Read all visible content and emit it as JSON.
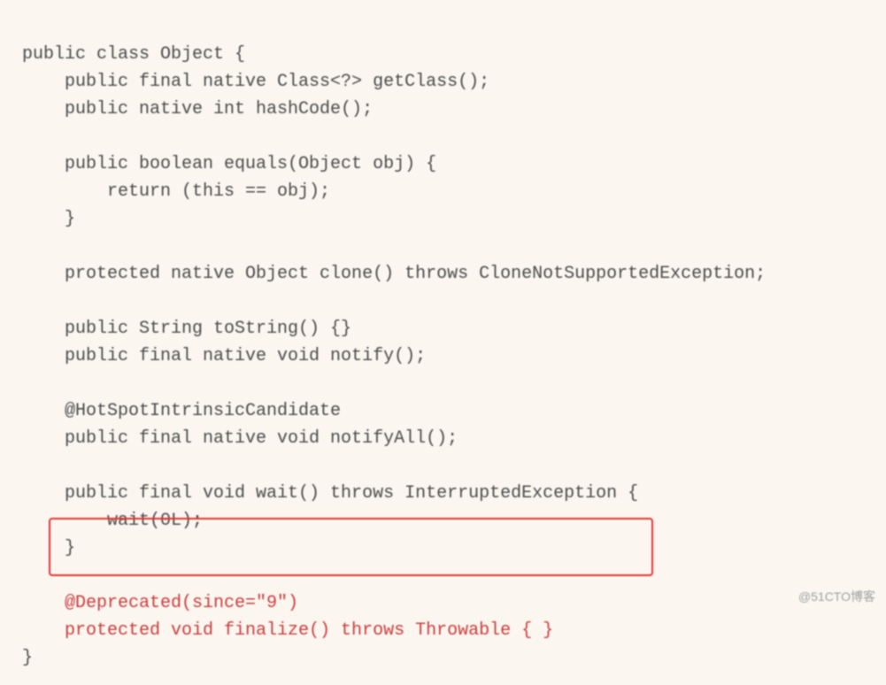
{
  "code": {
    "line1": "public class Object {",
    "line2": "    public final native Class<?> getClass();",
    "line3": "    public native int hashCode();",
    "line4": "",
    "line5": "    public boolean equals(Object obj) {",
    "line6": "        return (this == obj);",
    "line7": "    }",
    "line8": "",
    "line9": "    protected native Object clone() throws CloneNotSupportedException;",
    "line10": "",
    "line11": "    public String toString() {}",
    "line12": "    public final native void notify();",
    "line13": "",
    "line14": "    @HotSpotIntrinsicCandidate",
    "line15": "    public final native void notifyAll();",
    "line16": "",
    "line17": "    public final void wait() throws InterruptedException {",
    "line18": "        wait(0L);",
    "line19": "    }",
    "line20": "",
    "line21": "    @Deprecated(since=\"9\")",
    "line22": "    protected void finalize() throws Throwable { }",
    "line23": "}"
  },
  "watermark": "@51CTO博客"
}
